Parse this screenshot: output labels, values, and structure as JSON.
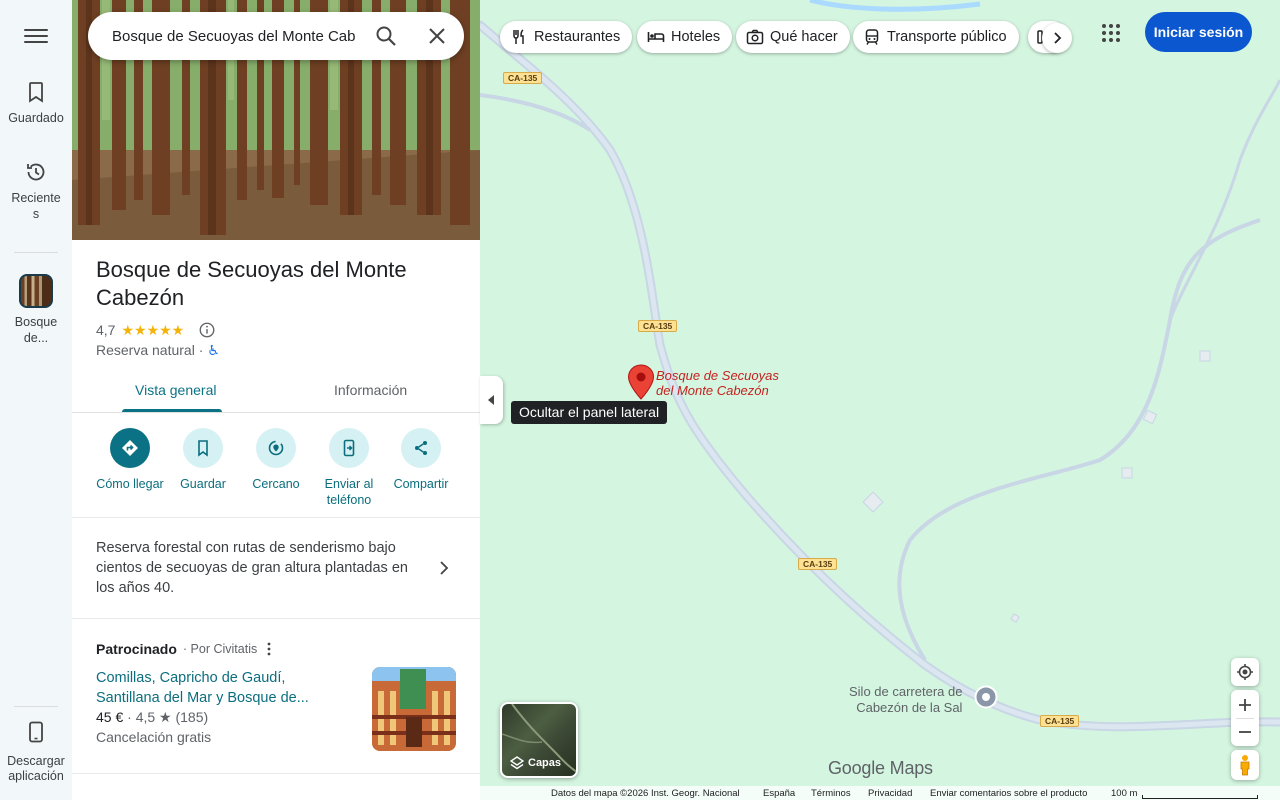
{
  "rail": {
    "saved": "Guardado",
    "recent": "Recientes",
    "recent_line2": "s",
    "recent_line1": "Reciente",
    "saved_place_line1": "Bosque",
    "saved_place_line2": "de...",
    "download_line1": "Descargar",
    "download_line2": "aplicación"
  },
  "search": {
    "value": "Bosque de Secuoyas del Monte Cab"
  },
  "place": {
    "title": "Bosque de Secuoyas del Monte Cabezón",
    "rating": "4,7",
    "stars": "★★★★★",
    "category": "Reserva natural",
    "dot": "·",
    "accessibility": "♿"
  },
  "tabs": {
    "overview": "Vista general",
    "info": "Información"
  },
  "actions": {
    "directions": "Cómo llegar",
    "save": "Guardar",
    "nearby": "Cercano",
    "send_line1": "Enviar al",
    "send_line2": "teléfono",
    "share": "Compartir"
  },
  "description": "Reserva forestal con rutas de senderismo bajo cientos de secuoyas de gran altura plantadas en los años 40.",
  "ad": {
    "sponsored": "Patrocinado",
    "by": "· Por Civitatis",
    "title": "Comillas, Capricho de Gaudí, Santillana del Mar y Bosque de...",
    "price": "45 €",
    "rating_text": "· 4,5 ★ (185)",
    "cancel": "Cancelación gratis"
  },
  "chips": [
    "Restaurantes",
    "Hoteles",
    "Qué hacer",
    "Transporte público"
  ],
  "signin": "Iniciar sesión",
  "map": {
    "road": "CA-135",
    "pin_line1": "Bosque de Secuoyas",
    "pin_line2": "del Monte Cabezón",
    "poi_line1": "Silo de carretera de",
    "poi_line2": "Cabezón de la Sal",
    "tooltip": "Ocultar el panel lateral",
    "layers": "Capas",
    "brand": "Google Maps"
  },
  "footer": {
    "data": "Datos del mapa ©2026 Inst. Geogr. Nacional",
    "country": "España",
    "terms": "Términos",
    "privacy": "Privacidad",
    "feedback": "Enviar comentarios sobre el producto",
    "scale": "100 m"
  },
  "colors": {
    "accent": "#0b7285",
    "map_bg": "#d4f5e0",
    "road": "#c8d6e5",
    "pin": "#ea4335",
    "signin": "#0b57d0"
  }
}
